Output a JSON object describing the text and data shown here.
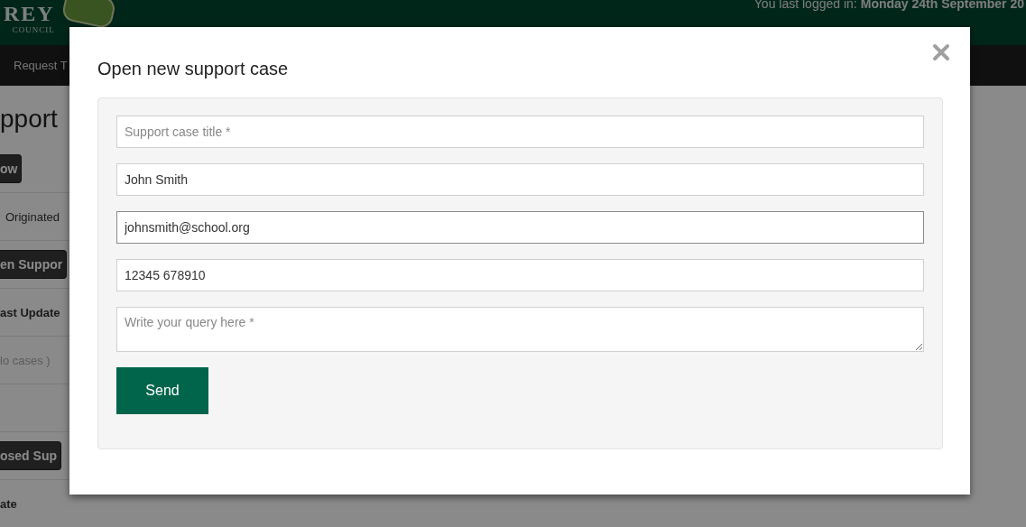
{
  "header": {
    "logo_text": "REY",
    "logo_subtext": "COUNCIL",
    "last_login_label": "You last logged in:",
    "last_login_value": "Monday 24th September 20"
  },
  "nav": {
    "items": [
      "Request T"
    ]
  },
  "page": {
    "heading": "pport",
    "items": [
      {
        "kind": "button",
        "text": "ow"
      },
      {
        "kind": "text",
        "text": "Originated"
      },
      {
        "kind": "button",
        "text": "en Suppor"
      },
      {
        "kind": "bold",
        "text": "ast Update"
      },
      {
        "kind": "muted",
        "text": "lo cases )"
      },
      {
        "kind": "blank"
      },
      {
        "kind": "button",
        "text": "osed Sup"
      },
      {
        "kind": "bold",
        "text": "ate"
      }
    ]
  },
  "modal": {
    "title": "Open new support case",
    "fields": [
      {
        "kind": "input",
        "placeholder": "Support case title *",
        "focused": false
      },
      {
        "kind": "input",
        "value": "John Smith",
        "focused": false
      },
      {
        "kind": "input",
        "value": "johnsmith@school.org",
        "focused": true
      },
      {
        "kind": "input",
        "value": "12345 678910",
        "focused": false
      },
      {
        "kind": "textarea",
        "placeholder": "Write your query here *",
        "focused": false
      }
    ],
    "send_button": "Send"
  }
}
